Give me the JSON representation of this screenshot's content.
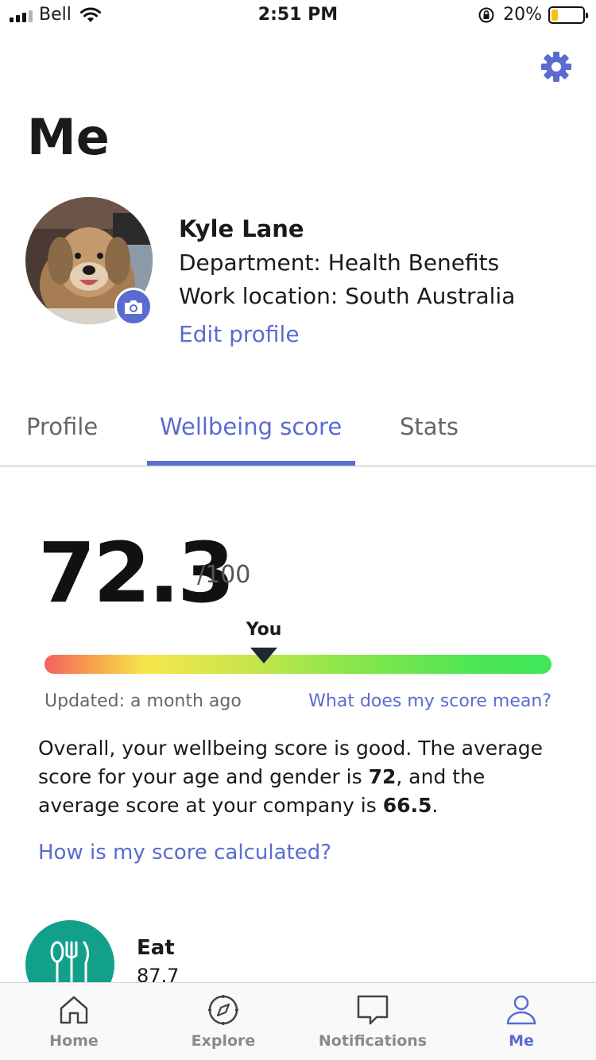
{
  "status_bar": {
    "carrier": "Bell",
    "time": "2:51 PM",
    "battery": "20%",
    "battery_level": 0.2
  },
  "header": {
    "title": "Me",
    "settings_icon": "gear-icon"
  },
  "profile": {
    "name": "Kyle Lane",
    "department": "Department: Health Benefits",
    "location": "Work location: South Australia",
    "edit_label": "Edit profile",
    "camera_icon": "camera-icon"
  },
  "tabs": [
    {
      "label": "Profile",
      "active": false
    },
    {
      "label": "Wellbeing score",
      "active": true
    },
    {
      "label": "Stats",
      "active": false
    }
  ],
  "score": {
    "value": "72.3",
    "max": "/100",
    "marker_label": "You",
    "marker_fraction": 0.433,
    "updated": "Updated: a month ago",
    "meaning_link": "What does my score mean?",
    "summary_prefix": "Overall, your wellbeing score is good. The average score for your age and gender is ",
    "age_avg": "72",
    "summary_mid": ", and the average score at your company is ",
    "company_avg": "66.5",
    "summary_suffix": ".",
    "calc_link": "How is my score calculated?"
  },
  "categories": [
    {
      "name": "Eat",
      "score": "87.7",
      "icon": "cutlery-icon",
      "color": "#13a08a"
    }
  ],
  "nav": [
    {
      "label": "Home",
      "icon": "home-icon",
      "active": false
    },
    {
      "label": "Explore",
      "icon": "compass-icon",
      "active": false
    },
    {
      "label": "Notifications",
      "icon": "chat-bubble-icon",
      "active": false
    },
    {
      "label": "Me",
      "icon": "person-icon",
      "active": true
    }
  ],
  "colors": {
    "accent": "#5a6bd1",
    "eat": "#13a08a"
  }
}
